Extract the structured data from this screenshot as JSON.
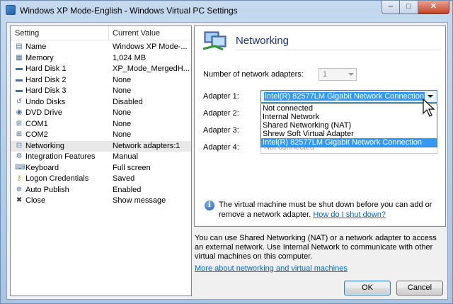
{
  "window": {
    "title": "Windows XP Mode-English - Windows Virtual PC Settings"
  },
  "caption_buttons": {
    "minimize": "–",
    "maximize": "□",
    "close": "✕"
  },
  "settings_list": {
    "col_setting": "Setting",
    "col_value": "Current Value",
    "rows": [
      {
        "name": "Name",
        "value": "Windows XP Mode-...",
        "icon": "document-icon"
      },
      {
        "name": "Memory",
        "value": "1,024 MB",
        "icon": "memory-icon"
      },
      {
        "name": "Hard Disk 1",
        "value": "XP_Mode_MergedH...",
        "icon": "hard-disk-icon"
      },
      {
        "name": "Hard Disk 2",
        "value": "None",
        "icon": "hard-disk-icon"
      },
      {
        "name": "Hard Disk 3",
        "value": "None",
        "icon": "hard-disk-icon"
      },
      {
        "name": "Undo Disks",
        "value": "Disabled",
        "icon": "undo-disk-icon"
      },
      {
        "name": "DVD Drive",
        "value": "None",
        "icon": "dvd-drive-icon"
      },
      {
        "name": "COM1",
        "value": "None",
        "icon": "com-port-icon"
      },
      {
        "name": "COM2",
        "value": "None",
        "icon": "com-port-icon"
      },
      {
        "name": "Networking",
        "value": "Network adapters:1",
        "icon": "network-icon",
        "selected": true
      },
      {
        "name": "Integration Features",
        "value": "Manual",
        "icon": "integration-icon"
      },
      {
        "name": "Keyboard",
        "value": "Full screen",
        "icon": "keyboard-icon"
      },
      {
        "name": "Logon Credentials",
        "value": "Saved",
        "icon": "key-icon"
      },
      {
        "name": "Auto Publish",
        "value": "Enabled",
        "icon": "auto-publish-icon"
      },
      {
        "name": "Close",
        "value": "Show message",
        "icon": "close-x-icon"
      }
    ]
  },
  "networking": {
    "title": "Networking",
    "num_adapters_label": "Number of network adapters:",
    "num_adapters_value": "1",
    "adapter1_label": "Adapter 1:",
    "adapter1_value": "Intel(R) 82577LM Gigabit Network Connection",
    "adapter2_label": "Adapter 2:",
    "adapter3_label": "Adapter 3:",
    "adapter4_label": "Adapter 4:",
    "adapter4_value": "Not connected",
    "dropdown_options": [
      "Not connected",
      "Internal Network",
      "Shared Networking (NAT)",
      "Shrew Soft Virtual Adapter",
      "Intel(R) 82577LM Gigabit Network Connection"
    ],
    "highlighted_option_index": 4,
    "info_text": "The virtual machine must be shut down before you can add or remove a network adapter.",
    "info_link": "How do I shut down?"
  },
  "footer": {
    "description": "You can use Shared Networking (NAT) or a network adapter to access an external network. Use Internal Network to communicate with other virtual machines on this computer.",
    "more_link": "More about networking and virtual machines",
    "ok_label": "OK",
    "cancel_label": "Cancel"
  },
  "colors": {
    "section_title": "#1e3287",
    "link": "#0066cc",
    "highlight": "#3399ff"
  }
}
